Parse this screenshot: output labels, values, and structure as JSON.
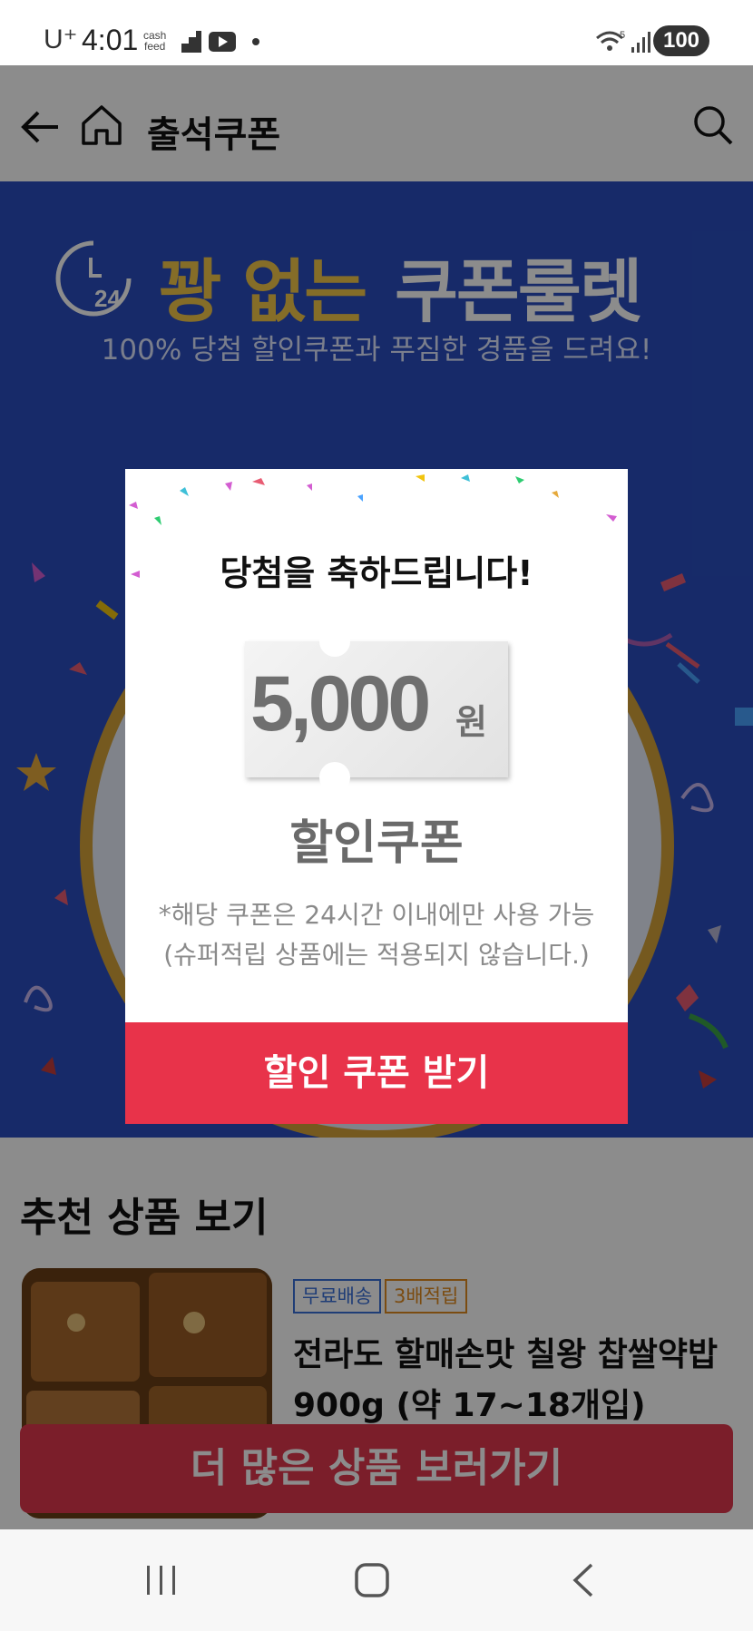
{
  "status_bar": {
    "carrier": "U⁺",
    "time": "4:01",
    "cash_app": "cash\nfeed",
    "battery": "100",
    "network": "5"
  },
  "header": {
    "title": "출석쿠폰",
    "back_icon": "arrow-left-icon",
    "home_icon": "home-icon",
    "search_icon": "search-icon"
  },
  "hero": {
    "timer_label": "24",
    "title_part1": "꽝 없는",
    "title_part2": "쿠폰룰렛",
    "subtitle": "100% 당첨 할인쿠폰과 푸짐한 경품을 드려요!",
    "accent_gold": "#f3c64a",
    "background": "#2a4ec0"
  },
  "modal": {
    "title": "당첨을 축하드립니다!",
    "coupon_amount": "5,000",
    "coupon_unit": "원",
    "coupon_type": "할인쿠폰",
    "note_line1": "*해당 쿠폰은 24시간 이내에만 사용 가능",
    "note_line2": "(슈퍼적립 상품에는 적용되지 않습니다.)",
    "button_label": "할인 쿠폰 받기",
    "button_color": "#e8334a"
  },
  "recommended": {
    "title": "추천 상품 보기",
    "product": {
      "badge_free": "무료배송",
      "badge_points": "3배적립",
      "name": "전라도 할매손맛 칠왕 찹쌀약밥 900g (약 17~18개입)",
      "discount_badge": "%"
    },
    "more_button": "더 많은 상품 보러가기"
  },
  "nav": {
    "recents_icon": "recent-apps-icon",
    "home_icon": "home-button-icon",
    "back_icon": "back-icon"
  }
}
